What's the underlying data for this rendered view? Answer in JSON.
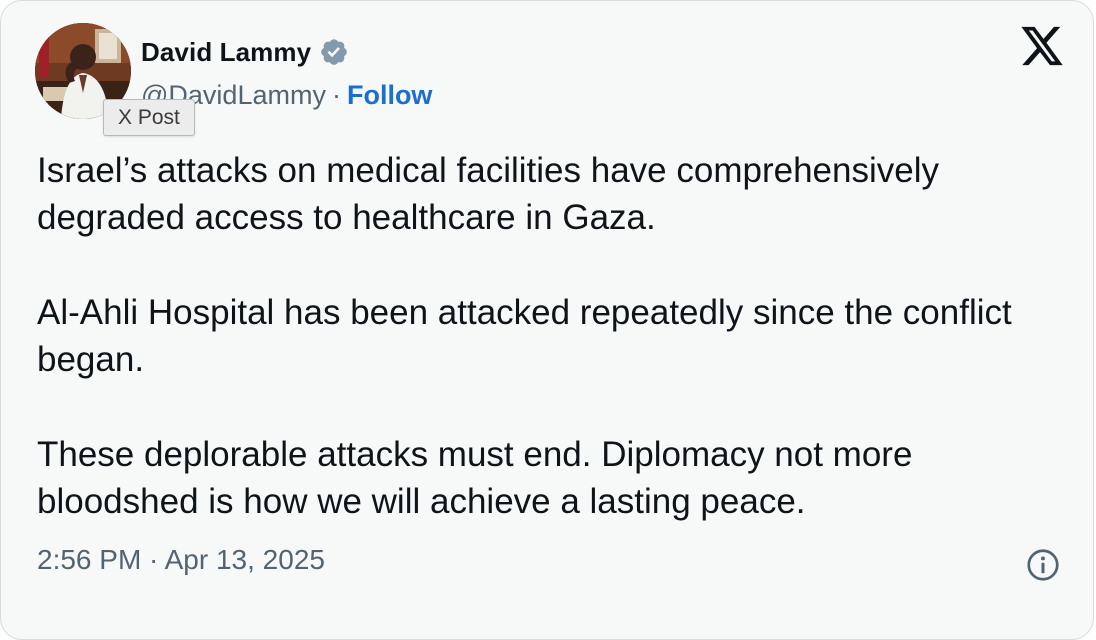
{
  "tooltip": {
    "text": "X Post"
  },
  "author": {
    "name": "David Lammy",
    "handle": "@DavidLammy",
    "separator": "·",
    "follow_label": "Follow",
    "verified": true,
    "avatar_icon": "profile-photo",
    "verified_icon": "verified-badge-icon"
  },
  "brand": {
    "logo_icon": "x-logo-icon"
  },
  "post": {
    "paragraphs": [
      "Israel’s attacks on medical facilities have comprehensively degraded access to healthcare in Gaza.",
      "Al-Ahli Hospital has been attacked repeatedly since the conflict began.",
      "These deplorable attacks must end. Diplomacy not more bloodshed is how we will achieve a lasting peace."
    ],
    "timestamp": "2:56 PM · Apr 13, 2025"
  },
  "footer": {
    "info_icon": "info-icon"
  },
  "colors": {
    "background": "#f7f9f9",
    "text": "#0f1419",
    "muted": "#536471",
    "link": "#1d6fcf",
    "verified": "#829aab"
  }
}
